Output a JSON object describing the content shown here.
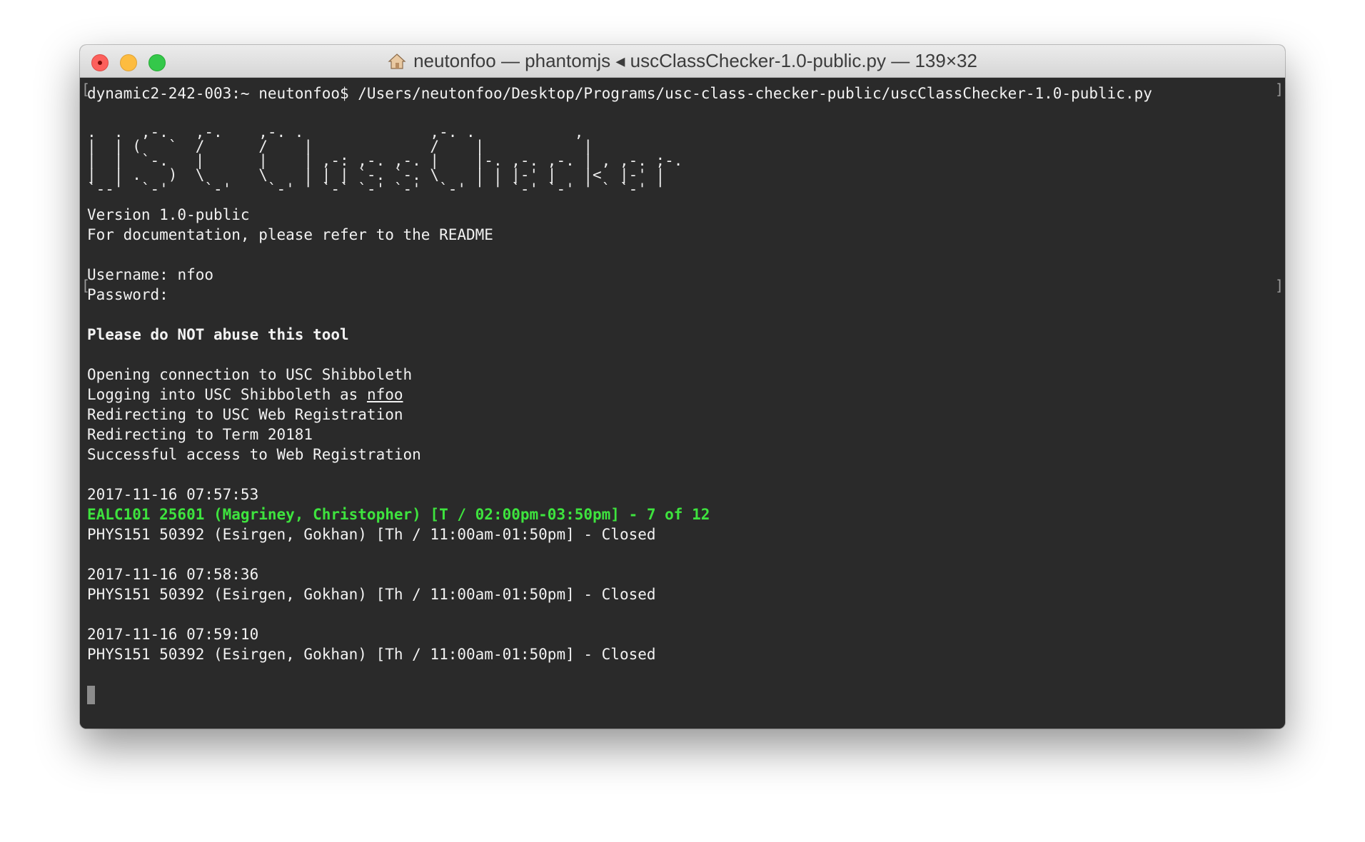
{
  "window": {
    "title": "neutonfoo — phantomjs ◂ uscClassChecker-1.0-public.py — 139×32",
    "title_icon": "home-folder-icon"
  },
  "terminal": {
    "prompt_line": "dynamic2-242-003:~ neutonfoo$ /Users/neutonfoo/Desktop/Programs/usc-class-checker-public/uscClassChecker-1.0-public.py",
    "ascii_banner": ".  .  ,-.   ,-.    ,-. .              ,-. .           ,\n|  | (   `  /      /    |             /    |           |\n|  |  `-.   |      |    | ,-: ,-. ,-. |    |-. ,-. ,-. | , ,-. ;-.\n|  | .   )  \\      \\    | | | `-. `-. \\    | | |-' |   |<  |-' |\n`--'  `-'    `-'    `-' ' `-` `-' `-'  `-' ' ' `-' `-' ' ` `-' '",
    "version": "Version 1.0-public",
    "docs": "For documentation, please refer to the README",
    "username_label": "Username: ",
    "username_value": "nfoo",
    "password_label": "Password:",
    "warning": "Please do NOT abuse this tool",
    "log": {
      "l1": "Opening connection to USC Shibboleth",
      "l2_prefix": "Logging into USC Shibboleth as ",
      "l2_user": "nfoo",
      "l3": "Redirecting to USC Web Registration",
      "l4": "Redirecting to Term 20181",
      "l5": "Successful access to Web Registration"
    },
    "checks": {
      "c1_time": "2017-11-16 07:57:53",
      "c1_open": "EALC101 25601 (Magriney, Christopher) [T / 02:00pm-03:50pm] - 7 of 12",
      "c1_closed": "PHYS151 50392 (Esirgen, Gokhan) [Th / 11:00am-01:50pm] - Closed",
      "c2_time": "2017-11-16 07:58:36",
      "c2_closed": "PHYS151 50392 (Esirgen, Gokhan) [Th / 11:00am-01:50pm] - Closed",
      "c3_time": "2017-11-16 07:59:10",
      "c3_closed": "PHYS151 50392 (Esirgen, Gokhan) [Th / 11:00am-01:50pm] - Closed"
    },
    "marks": {
      "open": "[",
      "close": "]"
    }
  },
  "colors": {
    "terminal_bg": "#2a2a2a",
    "text": "#f2f2f2",
    "open_class": "#3ee33e"
  }
}
